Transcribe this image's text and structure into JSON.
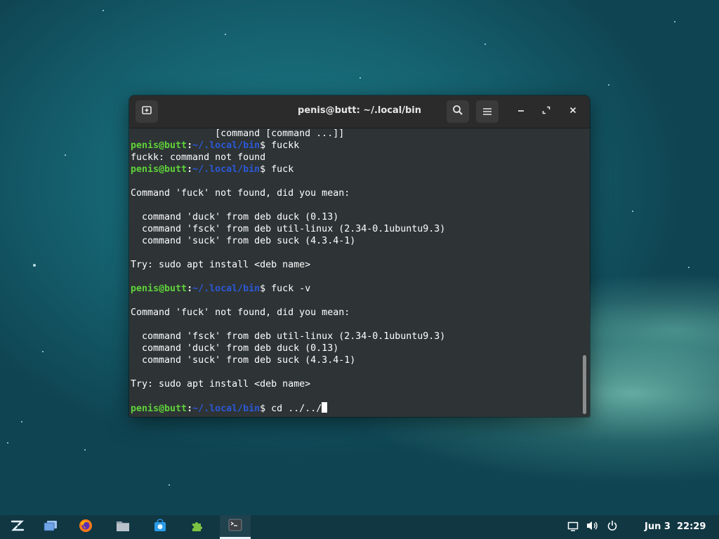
{
  "window": {
    "title": "penis@butt: ~/.local/bin",
    "icons": {
      "new_tab": "new-tab-icon",
      "search": "search-icon",
      "menu": "hamburger-menu-icon",
      "minimize": "minimize-icon",
      "maximize": "maximize-icon",
      "close": "close-icon"
    }
  },
  "terminal": {
    "prompt_user": "penis@butt",
    "prompt_colon": ":",
    "prompt_path": "~/.local/bin",
    "prompt_suffix": "$ ",
    "lines": [
      {
        "type": "text",
        "text": "               [command [command ...]]"
      },
      {
        "type": "prompt",
        "cmd": "fuckk"
      },
      {
        "type": "text",
        "text": "fuckk: command not found"
      },
      {
        "type": "prompt",
        "cmd": "fuck"
      },
      {
        "type": "text",
        "text": ""
      },
      {
        "type": "text",
        "text": "Command 'fuck' not found, did you mean:"
      },
      {
        "type": "text",
        "text": ""
      },
      {
        "type": "text",
        "text": "  command 'duck' from deb duck (0.13)"
      },
      {
        "type": "text",
        "text": "  command 'fsck' from deb util-linux (2.34-0.1ubuntu9.3)"
      },
      {
        "type": "text",
        "text": "  command 'suck' from deb suck (4.3.4-1)"
      },
      {
        "type": "text",
        "text": ""
      },
      {
        "type": "text",
        "text": "Try: sudo apt install <deb name>"
      },
      {
        "type": "text",
        "text": ""
      },
      {
        "type": "prompt",
        "cmd": "fuck -v"
      },
      {
        "type": "text",
        "text": ""
      },
      {
        "type": "text",
        "text": "Command 'fuck' not found, did you mean:"
      },
      {
        "type": "text",
        "text": ""
      },
      {
        "type": "text",
        "text": "  command 'fsck' from deb util-linux (2.34-0.1ubuntu9.3)"
      },
      {
        "type": "text",
        "text": "  command 'duck' from deb duck (0.13)"
      },
      {
        "type": "text",
        "text": "  command 'suck' from deb suck (4.3.4-1)"
      },
      {
        "type": "text",
        "text": ""
      },
      {
        "type": "text",
        "text": "Try: sudo apt install <deb name>"
      },
      {
        "type": "text",
        "text": ""
      },
      {
        "type": "prompt",
        "cmd": "cd ../../",
        "cursor": true
      }
    ]
  },
  "taskbar": {
    "apps": [
      {
        "name": "zorin-menu-icon",
        "active": false
      },
      {
        "name": "workspaces-icon",
        "active": false
      },
      {
        "name": "firefox-icon",
        "active": false
      },
      {
        "name": "files-icon",
        "active": false
      },
      {
        "name": "software-store-icon",
        "active": false
      },
      {
        "name": "extensions-icon",
        "active": false
      },
      {
        "name": "terminal-icon",
        "active": true
      }
    ],
    "tray": [
      "display-icon",
      "volume-icon",
      "power-icon"
    ],
    "date": "Jun 3",
    "time": "22:29"
  },
  "colors": {
    "terminal_bg": "#2e3436",
    "prompt_user": "#5fd33a",
    "prompt_path": "#2b58d6",
    "titlebar_bg": "#2b2b2b"
  }
}
